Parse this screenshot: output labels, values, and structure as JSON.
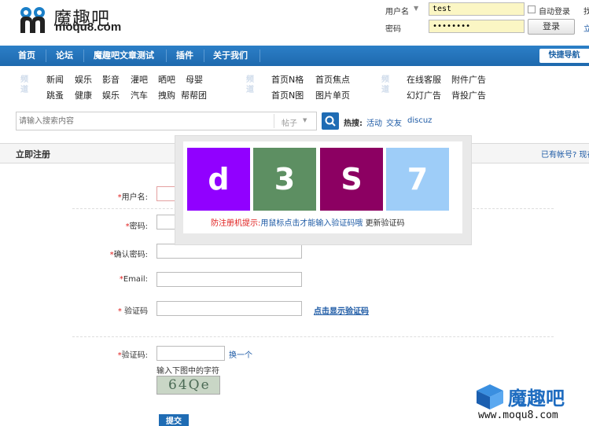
{
  "header": {
    "brand_cn": "魔趣吧",
    "brand_en": "moqu8.com",
    "login": {
      "username_label": "用户名",
      "username_value": "test",
      "password_label": "密码",
      "password_value": "••••••••",
      "auto_login_label": "自动登录",
      "login_button": "登录",
      "extra_top": "找",
      "extra_bottom": "立"
    }
  },
  "nav": {
    "items": [
      "首页",
      "论坛",
      "魔趣吧文章测试",
      "插件",
      "关于我们"
    ],
    "quick_nav": "快捷导航"
  },
  "subnav": {
    "groups": [
      {
        "tag": "频道",
        "row1": [
          "新闻",
          "娱乐",
          "影音",
          "灌吧",
          "晒吧",
          "母婴"
        ],
        "row2": [
          "跳蚤",
          "健康",
          "娱乐",
          "汽车",
          "拽购",
          "帮帮团"
        ]
      },
      {
        "tag": "频道",
        "row1": [
          "首页N格",
          "首页焦点"
        ],
        "row2": [
          "首页N图",
          "图片单页"
        ]
      },
      {
        "tag": "频道",
        "row1": [
          "在线客服",
          "附件广告"
        ],
        "row2": [
          "幻灯广告",
          "背投广告"
        ]
      }
    ]
  },
  "search": {
    "placeholder": "请输入搜索内容",
    "scope": "帖子",
    "hot_label": "热搜:",
    "hot_terms": [
      "活动",
      "交友",
      "discuz"
    ]
  },
  "register": {
    "title": "立即注册",
    "have_account": "已有帐号? 现在",
    "fields": {
      "username": "用户名:",
      "password": "密码:",
      "confirm_password": "确认密码:",
      "email": "Email:",
      "captcha": "验证码",
      "captcha2": "验证码:"
    },
    "show_captcha_link": "点击显示验证码",
    "change_link": "换一个",
    "captcha_hint": "输入下图中的字符",
    "captcha_image_text": "64Qe",
    "submit": "提交"
  },
  "popup": {
    "tiles": [
      {
        "char": "d",
        "color": "#9100ff"
      },
      {
        "char": "3",
        "color": "#5d8f62"
      },
      {
        "char": "S",
        "color": "#8c0062"
      },
      {
        "char": "7",
        "color": "#9ecdf8"
      }
    ],
    "tip_label": "防注册机提示:",
    "tip_text": "用鼠标点击才能输入验证码哦",
    "refresh": "更新验证码"
  },
  "watermark": {
    "cn": "魔趣吧",
    "url": "www.moqu8.com"
  }
}
